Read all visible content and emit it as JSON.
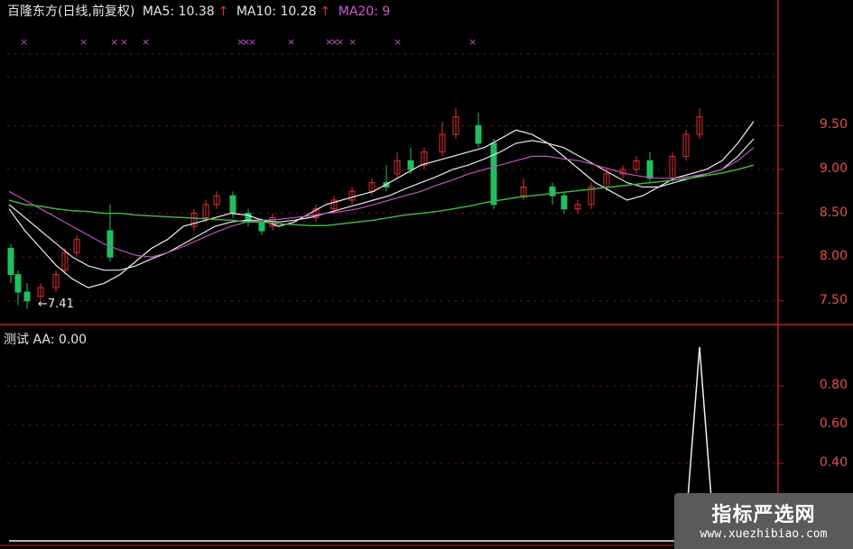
{
  "header": {
    "stock": "百隆东方(日线,前复权)",
    "ma5_label": "MA5: 10.38",
    "ma10_label": "MA10: 10.28",
    "ma20_label": "MA20: 9",
    "arrow": "↑"
  },
  "low_marker": "←7.41",
  "sub_header": "测试  AA: 0.00",
  "watermark": {
    "title": "指标严选网",
    "url": "www.xuezhibiao.com"
  },
  "colors": {
    "up": "#e03030",
    "down": "#20c060",
    "ma5": "#f0f0f0",
    "ma10": "#e8e8e8",
    "ma20": "#c050c0",
    "ma60": "#40b040",
    "axis": "#c02020",
    "grid": "#8a1515"
  },
  "chart_data": [
    {
      "type": "candlestick",
      "title": "百隆东方(日线,前复权)",
      "ylim": [
        7.25,
        9.7
      ],
      "yticks": [
        "9.50",
        "9.00",
        "8.50",
        "8.00",
        "7.50"
      ],
      "ytick_values": [
        9.5,
        9.0,
        8.5,
        8.0,
        7.5
      ],
      "low_annotation": 7.41,
      "series": [
        {
          "name": "MA5",
          "values": [
            8.55,
            8.3,
            8.1,
            7.9,
            7.75,
            7.65,
            7.7,
            7.8,
            7.95,
            8.1,
            8.2,
            8.35,
            8.4,
            8.45,
            8.5,
            8.48,
            8.42,
            8.35,
            8.4,
            8.5,
            8.6,
            8.65,
            8.7,
            8.75,
            8.85,
            8.95,
            9.05,
            9.1,
            9.15,
            9.2,
            9.25,
            9.35,
            9.45,
            9.4,
            9.3,
            9.15,
            9.0,
            8.85,
            8.75,
            8.65,
            8.7,
            8.8,
            8.9,
            8.95,
            9.0,
            9.1,
            9.3,
            9.55
          ]
        },
        {
          "name": "MA10",
          "values": [
            8.6,
            8.45,
            8.3,
            8.15,
            8.0,
            7.9,
            7.85,
            7.85,
            7.9,
            7.98,
            8.05,
            8.15,
            8.25,
            8.35,
            8.4,
            8.42,
            8.42,
            8.4,
            8.42,
            8.45,
            8.5,
            8.55,
            8.6,
            8.65,
            8.7,
            8.78,
            8.85,
            8.92,
            9.0,
            9.05,
            9.12,
            9.2,
            9.3,
            9.33,
            9.3,
            9.25,
            9.15,
            9.05,
            8.95,
            8.85,
            8.8,
            8.8,
            8.85,
            8.9,
            8.95,
            9.0,
            9.15,
            9.35
          ]
        },
        {
          "name": "MA20",
          "values": [
            8.75,
            8.65,
            8.55,
            8.45,
            8.35,
            8.25,
            8.15,
            8.08,
            8.02,
            8.0,
            8.05,
            8.12,
            8.2,
            8.28,
            8.35,
            8.4,
            8.42,
            8.43,
            8.45,
            8.47,
            8.5,
            8.52,
            8.55,
            8.6,
            8.65,
            8.7,
            8.75,
            8.82,
            8.88,
            8.95,
            9.0,
            9.05,
            9.1,
            9.15,
            9.15,
            9.12,
            9.1,
            9.05,
            9.0,
            8.95,
            8.92,
            8.9,
            8.9,
            8.92,
            8.95,
            9.0,
            9.1,
            9.25
          ]
        },
        {
          "name": "MA60",
          "values": [
            8.65,
            8.6,
            8.58,
            8.55,
            8.53,
            8.52,
            8.5,
            8.5,
            8.48,
            8.47,
            8.46,
            8.45,
            8.44,
            8.43,
            8.42,
            8.4,
            8.4,
            8.38,
            8.37,
            8.36,
            8.36,
            8.38,
            8.4,
            8.42,
            8.45,
            8.48,
            8.5,
            8.52,
            8.55,
            8.58,
            8.62,
            8.65,
            8.68,
            8.7,
            8.72,
            8.74,
            8.76,
            8.78,
            8.8,
            8.82,
            8.84,
            8.86,
            8.88,
            8.9,
            8.93,
            8.96,
            9.0,
            9.05
          ]
        }
      ],
      "candles": [
        [
          8.1,
          7.8,
          8.15,
          7.7
        ],
        [
          7.8,
          7.6,
          7.85,
          7.45
        ],
        [
          7.6,
          7.5,
          7.7,
          7.41
        ],
        [
          7.55,
          7.65,
          7.7,
          7.5
        ],
        [
          7.65,
          7.8,
          7.85,
          7.6
        ],
        [
          7.85,
          8.05,
          8.1,
          7.8
        ],
        [
          8.05,
          8.2,
          8.25,
          8.0
        ],
        [
          8.3,
          8.0,
          8.6,
          7.95
        ],
        [
          8.35,
          8.5,
          8.55,
          8.3
        ],
        [
          8.45,
          8.6,
          8.65,
          8.4
        ],
        [
          8.6,
          8.7,
          8.75,
          8.55
        ],
        [
          8.7,
          8.5,
          8.75,
          8.45
        ],
        [
          8.5,
          8.4,
          8.55,
          8.35
        ],
        [
          8.4,
          8.3,
          8.45,
          8.25
        ],
        [
          8.35,
          8.45,
          8.5,
          8.3
        ],
        [
          8.45,
          8.55,
          8.6,
          8.4
        ],
        [
          8.55,
          8.65,
          8.7,
          8.5
        ],
        [
          8.65,
          8.75,
          8.8,
          8.6
        ],
        [
          8.75,
          8.85,
          8.9,
          8.7
        ],
        [
          8.85,
          8.8,
          9.05,
          8.75
        ],
        [
          8.95,
          9.1,
          9.2,
          8.9
        ],
        [
          9.1,
          9.0,
          9.25,
          8.95
        ],
        [
          9.05,
          9.2,
          9.25,
          9.0
        ],
        [
          9.2,
          9.4,
          9.55,
          9.15
        ],
        [
          9.4,
          9.6,
          9.7,
          9.35
        ],
        [
          9.5,
          9.3,
          9.65,
          9.25
        ],
        [
          9.3,
          8.6,
          9.35,
          8.55
        ],
        [
          8.7,
          8.8,
          8.9,
          8.65
        ],
        [
          8.8,
          8.7,
          8.85,
          8.6
        ],
        [
          8.7,
          8.55,
          8.75,
          8.5
        ],
        [
          8.55,
          8.6,
          8.65,
          8.5
        ],
        [
          8.6,
          8.8,
          8.85,
          8.55
        ],
        [
          8.8,
          8.95,
          9.0,
          8.75
        ],
        [
          8.95,
          9.0,
          9.05,
          8.9
        ],
        [
          9.0,
          9.1,
          9.15,
          8.95
        ],
        [
          9.1,
          8.9,
          9.2,
          8.85
        ],
        [
          8.9,
          9.15,
          9.2,
          8.85
        ],
        [
          9.15,
          9.4,
          9.45,
          9.1
        ],
        [
          9.4,
          9.6,
          9.7,
          9.35
        ]
      ]
    },
    {
      "type": "line",
      "title": "测试",
      "series": [
        {
          "name": "AA",
          "values": [
            0,
            0,
            0,
            0,
            0,
            0,
            0,
            0,
            0,
            0,
            0,
            0,
            0,
            0,
            0,
            0,
            0,
            0,
            0,
            0,
            0,
            0,
            0,
            0,
            0,
            0,
            0,
            0,
            0,
            0,
            0,
            0,
            0,
            0,
            0,
            0,
            0,
            0,
            0,
            0,
            0,
            0,
            0,
            0,
            0,
            0,
            1,
            0
          ]
        }
      ],
      "ylim": [
        0,
        1.0
      ],
      "yticks": [
        "0.80",
        "0.60",
        "0.40"
      ],
      "ytick_values": [
        0.8,
        0.6,
        0.4
      ]
    }
  ]
}
